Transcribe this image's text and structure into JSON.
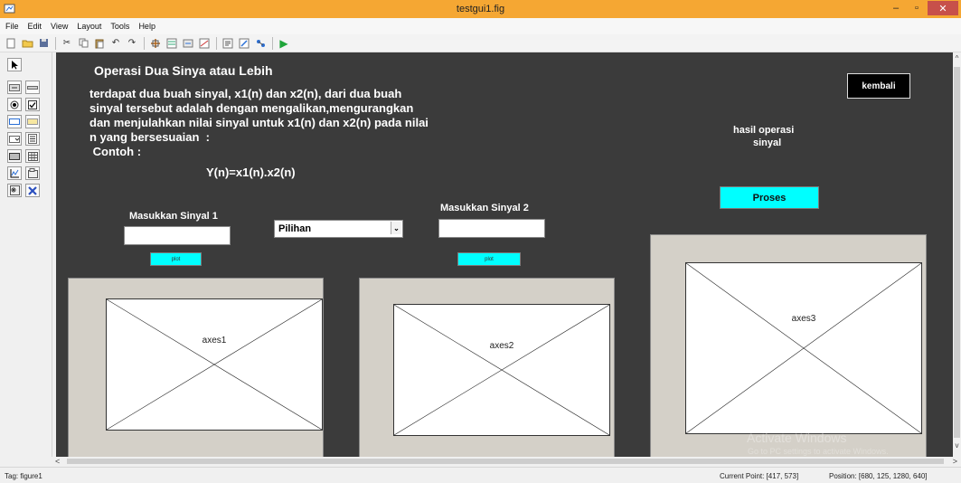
{
  "window": {
    "title": "testgui1.fig",
    "min_symbol": "–",
    "max_symbol": "▫",
    "close_symbol": "✕"
  },
  "menu": [
    "File",
    "Edit",
    "View",
    "Layout",
    "Tools",
    "Help"
  ],
  "toolbar_icons": [
    "new-file-icon",
    "open-folder-icon",
    "save-icon",
    "cut-icon",
    "copy-icon",
    "paste-icon",
    "undo-icon",
    "redo-icon",
    "align-icon",
    "menu-editor-icon",
    "tab-order-icon",
    "toolbar-editor-icon",
    "editor-icon",
    "property-inspector-icon",
    "object-browser-icon",
    "run-icon"
  ],
  "palette_icons": [
    "select-arrow-icon",
    "pushbutton-icon",
    "slider-icon",
    "radio-button-icon",
    "checkbox-icon",
    "edit-text-icon",
    "static-text-icon",
    "popup-menu-icon",
    "listbox-icon",
    "toggle-button-icon",
    "table-icon",
    "axes-icon",
    "panel-icon",
    "button-group-icon",
    "activex-icon"
  ],
  "canvas": {
    "background": "#3b3b3b",
    "heading": "Operasi Dua Sinya atau Lebih",
    "paragraph": "terdapat dua buah sinyal, x1(n) dan x2(n), dari dua buah\nsinyal tersebut adalah dengan mengalikan,mengurangkan\ndan menjulahkan nilai sinyal untuk x1(n) dan x2(n) pada nilai\nn yang bersesuaian  :\n Contoh :",
    "formula": "Y(n)=x1(n).x2(n)",
    "label_sinyal1": "Masukkan Sinyal 1",
    "label_sinyal2": "Masukkan Sinyal 2",
    "popup_value": "Pilihan",
    "plot1_label": "plot",
    "plot2_label": "plot",
    "hasil_label_line1": "hasil operasi",
    "hasil_label_line2": "sinyal",
    "proses_label": "Proses",
    "kembali_label": "kembali",
    "axes1_label": "axes1",
    "axes2_label": "axes2",
    "axes3_label": "axes3",
    "accent_cyan": "#00ffff",
    "panel_color": "#d4d0c8"
  },
  "watermark": {
    "line1": "Activate Windows",
    "line2": "Go to PC settings to activate Windows."
  },
  "status": {
    "tag": "Tag: figure1",
    "current_point": "Current Point:  [417, 573]",
    "position": "Position: [680, 125, 1280, 640]"
  }
}
